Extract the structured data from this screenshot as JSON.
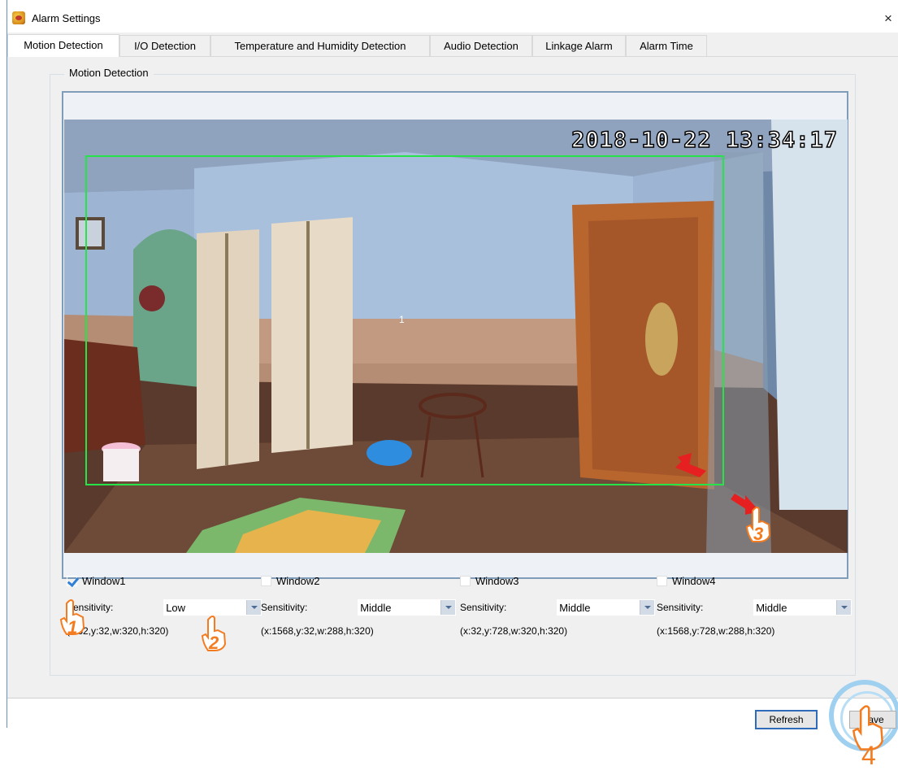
{
  "window": {
    "title": "Alarm Settings",
    "close_label": "×"
  },
  "tabs": [
    {
      "label": "Motion Detection",
      "active": true
    },
    {
      "label": "I/O Detection",
      "active": false
    },
    {
      "label": "Temperature and Humidity Detection",
      "active": false
    },
    {
      "label": "Audio Detection",
      "active": false
    },
    {
      "label": "Linkage Alarm",
      "active": false
    },
    {
      "label": "Alarm Time",
      "active": false
    }
  ],
  "group": {
    "title": "Motion Detection"
  },
  "video": {
    "timestamp": "2018-10-22 13:34:17",
    "window_label": "1",
    "detect_color": "#27e34a"
  },
  "windows": [
    {
      "label": "Window1",
      "checked": true,
      "sensitivity_label": "Sensitivity:",
      "sensitivity": "Low",
      "coords": "(x:32,y:32,w:320,h:320)"
    },
    {
      "label": "Window2",
      "checked": false,
      "sensitivity_label": "Sensitivity:",
      "sensitivity": "Middle",
      "coords": "(x:1568,y:32,w:288,h:320)"
    },
    {
      "label": "Window3",
      "checked": false,
      "sensitivity_label": "Sensitivity:",
      "sensitivity": "Middle",
      "coords": "(x:32,y:728,w:320,h:320)"
    },
    {
      "label": "Window4",
      "checked": false,
      "sensitivity_label": "Sensitivity:",
      "sensitivity": "Middle",
      "coords": "(x:1568,y:728,w:288,h:320)"
    }
  ],
  "buttons": {
    "refresh": "Refresh",
    "save": "Save"
  },
  "annotations": {
    "step1": "1",
    "step2": "2",
    "step3": "3",
    "step4": "4",
    "color": "#f47c20"
  }
}
